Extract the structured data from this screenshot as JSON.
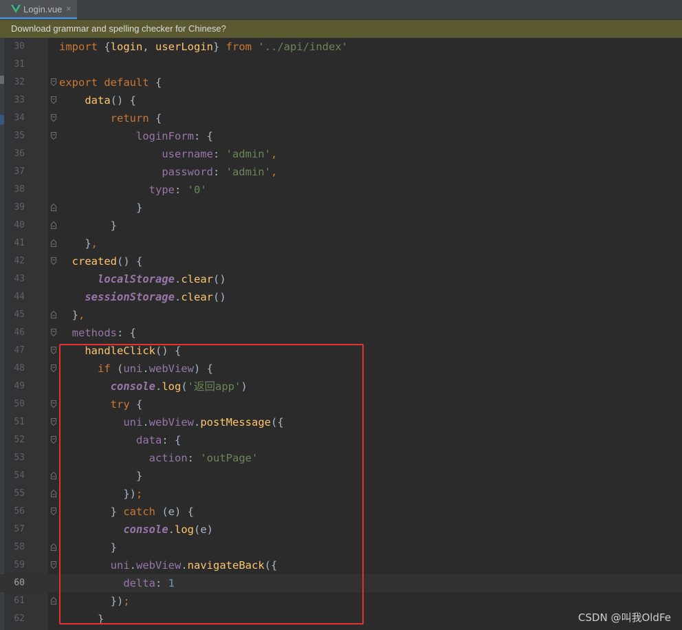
{
  "tab": {
    "label": "Login.vue",
    "close": "×",
    "icon": "vue-icon"
  },
  "banner": {
    "text": "Download grammar and spelling checker for Chinese?"
  },
  "watermark": "CSDN @叫我OldFe",
  "colors": {
    "keyword": "#cc7832",
    "string": "#6a8759",
    "property": "#9876aa",
    "function": "#ffc66d",
    "number": "#6897bb",
    "default": "#a9b7c6",
    "highlight_box": "#e8312e"
  },
  "lines": [
    {
      "num": "30",
      "code": [
        [
          "k",
          "import "
        ],
        [
          "d",
          "{"
        ],
        [
          "f",
          "login"
        ],
        [
          "d",
          ", "
        ],
        [
          "f",
          "userLogin"
        ],
        [
          "d",
          "} "
        ],
        [
          "k",
          "from "
        ],
        [
          "s",
          "'../api/index'"
        ]
      ]
    },
    {
      "num": "31",
      "code": []
    },
    {
      "num": "32",
      "code": [
        [
          "k",
          "export default "
        ],
        [
          "d",
          "{"
        ]
      ]
    },
    {
      "num": "33",
      "code": [
        [
          "d",
          "    "
        ],
        [
          "f",
          "data"
        ],
        [
          "d",
          "() {"
        ]
      ]
    },
    {
      "num": "34",
      "code": [
        [
          "d",
          "        "
        ],
        [
          "k",
          "return "
        ],
        [
          "d",
          "{"
        ]
      ]
    },
    {
      "num": "35",
      "code": [
        [
          "d",
          "            "
        ],
        [
          "p",
          "loginForm"
        ],
        [
          "d",
          ": {"
        ]
      ]
    },
    {
      "num": "36",
      "code": [
        [
          "d",
          "                "
        ],
        [
          "p",
          "username"
        ],
        [
          "d",
          ": "
        ],
        [
          "s",
          "'admin'"
        ],
        [
          "k",
          ","
        ]
      ]
    },
    {
      "num": "37",
      "code": [
        [
          "d",
          "                "
        ],
        [
          "p",
          "password"
        ],
        [
          "d",
          ": "
        ],
        [
          "s",
          "'admin'"
        ],
        [
          "k",
          ","
        ]
      ]
    },
    {
      "num": "38",
      "code": [
        [
          "d",
          "              "
        ],
        [
          "p",
          "type"
        ],
        [
          "d",
          ": "
        ],
        [
          "s",
          "'0'"
        ]
      ]
    },
    {
      "num": "39",
      "code": [
        [
          "d",
          "            }"
        ]
      ]
    },
    {
      "num": "40",
      "code": [
        [
          "d",
          "        }"
        ]
      ]
    },
    {
      "num": "41",
      "code": [
        [
          "d",
          "    }"
        ],
        [
          "k",
          ","
        ]
      ]
    },
    {
      "num": "42",
      "code": [
        [
          "d",
          "  "
        ],
        [
          "f",
          "created"
        ],
        [
          "d",
          "() {"
        ]
      ]
    },
    {
      "num": "43",
      "code": [
        [
          "d",
          "      "
        ],
        [
          "i",
          "localStorage"
        ],
        [
          "d",
          "."
        ],
        [
          "m",
          "clear"
        ],
        [
          "d",
          "()"
        ]
      ]
    },
    {
      "num": "44",
      "code": [
        [
          "d",
          "    "
        ],
        [
          "i",
          "sessionStorage"
        ],
        [
          "d",
          "."
        ],
        [
          "m",
          "clear"
        ],
        [
          "d",
          "()"
        ]
      ]
    },
    {
      "num": "45",
      "code": [
        [
          "d",
          "  }"
        ],
        [
          "k",
          ","
        ]
      ]
    },
    {
      "num": "46",
      "code": [
        [
          "d",
          "  "
        ],
        [
          "p",
          "methods"
        ],
        [
          "d",
          ": {"
        ]
      ]
    },
    {
      "num": "47",
      "code": [
        [
          "d",
          "    "
        ],
        [
          "f",
          "handleClick"
        ],
        [
          "d",
          "() {"
        ]
      ]
    },
    {
      "num": "48",
      "code": [
        [
          "d",
          "      "
        ],
        [
          "k",
          "if "
        ],
        [
          "d",
          "("
        ],
        [
          "p",
          "uni"
        ],
        [
          "d",
          "."
        ],
        [
          "p",
          "webView"
        ],
        [
          "d",
          ") {"
        ]
      ]
    },
    {
      "num": "49",
      "code": [
        [
          "d",
          "        "
        ],
        [
          "i",
          "console"
        ],
        [
          "d",
          "."
        ],
        [
          "m",
          "log"
        ],
        [
          "d",
          "("
        ],
        [
          "s",
          "'返回app'"
        ],
        [
          "d",
          ")"
        ]
      ]
    },
    {
      "num": "50",
      "code": [
        [
          "d",
          "        "
        ],
        [
          "k",
          "try "
        ],
        [
          "d",
          "{"
        ]
      ]
    },
    {
      "num": "51",
      "code": [
        [
          "d",
          "          "
        ],
        [
          "p",
          "uni"
        ],
        [
          "d",
          "."
        ],
        [
          "p",
          "webView"
        ],
        [
          "d",
          "."
        ],
        [
          "m",
          "postMessage"
        ],
        [
          "d",
          "({"
        ]
      ]
    },
    {
      "num": "52",
      "code": [
        [
          "d",
          "            "
        ],
        [
          "p",
          "data"
        ],
        [
          "d",
          ": {"
        ]
      ]
    },
    {
      "num": "53",
      "code": [
        [
          "d",
          "              "
        ],
        [
          "p",
          "action"
        ],
        [
          "d",
          ": "
        ],
        [
          "s",
          "'outPage'"
        ]
      ]
    },
    {
      "num": "54",
      "code": [
        [
          "d",
          "            }"
        ]
      ]
    },
    {
      "num": "55",
      "code": [
        [
          "d",
          "          })"
        ],
        [
          "k",
          ";"
        ]
      ]
    },
    {
      "num": "56",
      "code": [
        [
          "d",
          "        } "
        ],
        [
          "k",
          "catch "
        ],
        [
          "d",
          "(e) {"
        ]
      ]
    },
    {
      "num": "57",
      "code": [
        [
          "d",
          "          "
        ],
        [
          "i",
          "console"
        ],
        [
          "d",
          "."
        ],
        [
          "m",
          "log"
        ],
        [
          "d",
          "(e)"
        ]
      ]
    },
    {
      "num": "58",
      "code": [
        [
          "d",
          "        }"
        ]
      ]
    },
    {
      "num": "59",
      "code": [
        [
          "d",
          "        "
        ],
        [
          "p",
          "uni"
        ],
        [
          "d",
          "."
        ],
        [
          "p",
          "webView"
        ],
        [
          "d",
          "."
        ],
        [
          "m",
          "navigateBack"
        ],
        [
          "d",
          "({"
        ]
      ]
    },
    {
      "num": "60",
      "code": [
        [
          "d",
          "          "
        ],
        [
          "p",
          "delta"
        ],
        [
          "d",
          ": "
        ],
        [
          "n",
          "1"
        ]
      ],
      "current": true
    },
    {
      "num": "61",
      "code": [
        [
          "d",
          "        })"
        ],
        [
          "k",
          ";"
        ]
      ]
    },
    {
      "num": "62",
      "code": [
        [
          "d",
          "      }"
        ]
      ]
    }
  ],
  "folds": {
    "32": "open",
    "33": "open",
    "34": "open",
    "35": "open",
    "39": "close",
    "40": "close",
    "41": "close",
    "42": "open",
    "45": "close",
    "46": "open",
    "47": "open",
    "48": "open",
    "50": "open",
    "51": "open",
    "52": "open",
    "54": "close",
    "55": "close",
    "56": "open",
    "58": "close",
    "59": "open",
    "61": "close"
  }
}
